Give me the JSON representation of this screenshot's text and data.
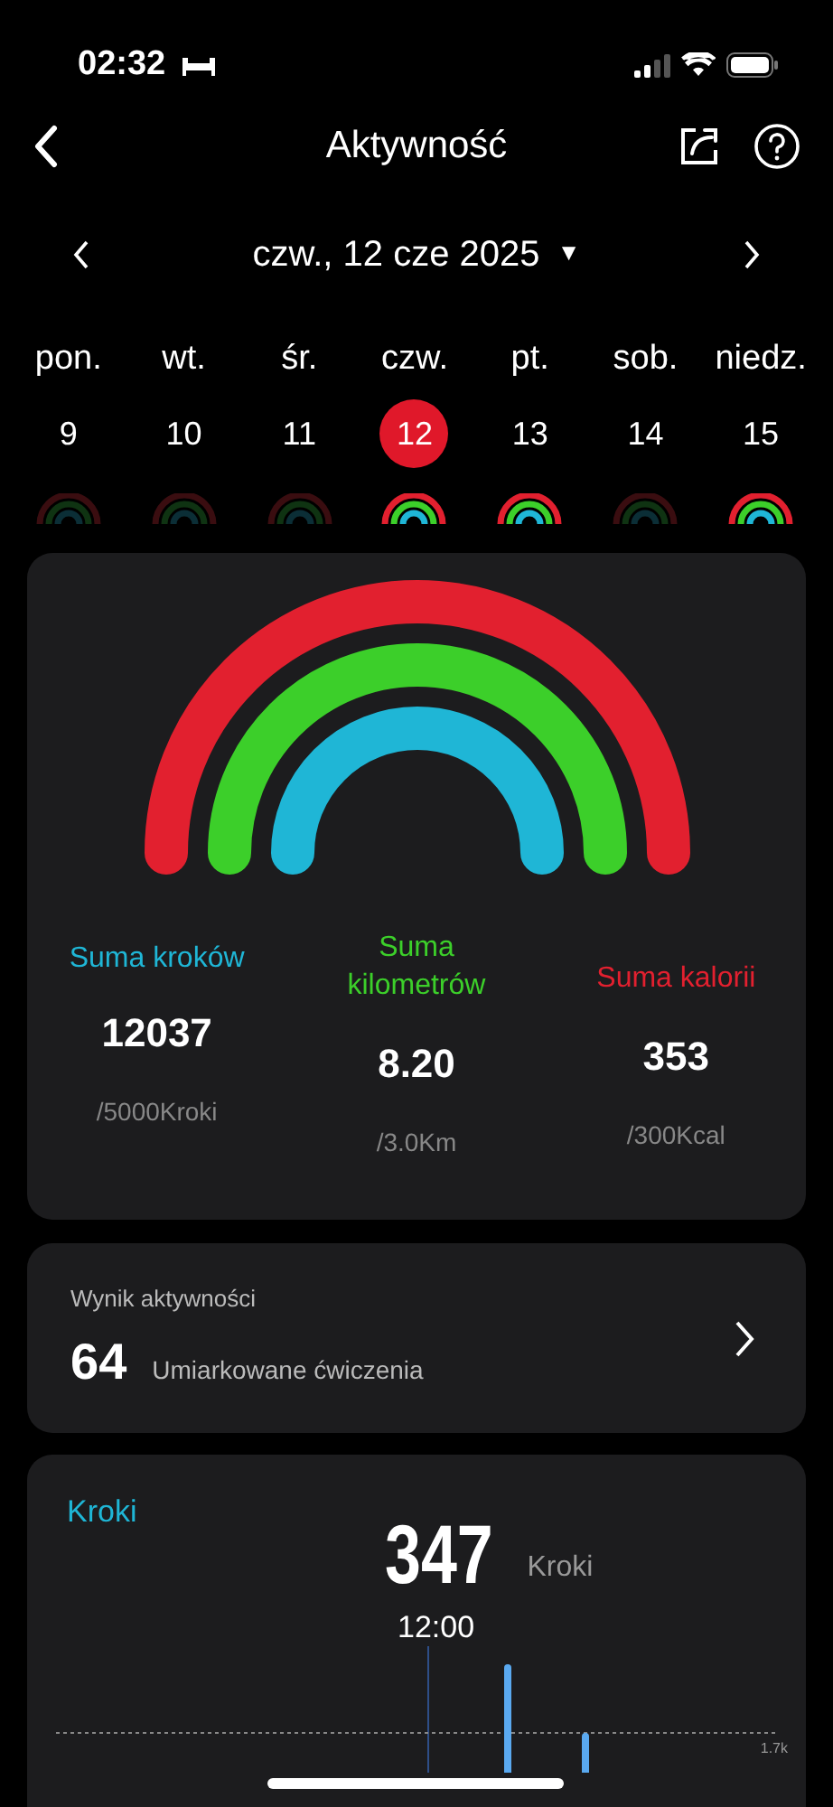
{
  "status_bar": {
    "time": "02:32"
  },
  "header": {
    "title": "Aktywność"
  },
  "date_nav": {
    "date": "czw., 12 cze 2025",
    "dropdown": "▼"
  },
  "week": [
    {
      "weekday": "pon.",
      "day": "9",
      "selected": false,
      "active": false
    },
    {
      "weekday": "wt.",
      "day": "10",
      "selected": false,
      "active": false
    },
    {
      "weekday": "śr.",
      "day": "11",
      "selected": false,
      "active": false
    },
    {
      "weekday": "czw.",
      "day": "12",
      "selected": true,
      "active": true
    },
    {
      "weekday": "pt.",
      "day": "13",
      "selected": false,
      "active": true
    },
    {
      "weekday": "sob.",
      "day": "14",
      "selected": false,
      "active": false
    },
    {
      "weekday": "niedz.",
      "day": "15",
      "selected": false,
      "active": true
    }
  ],
  "summary": [
    {
      "label": "Suma kroków",
      "value": "12037",
      "goal": "/5000Kroki",
      "color": "#1fb6d6"
    },
    {
      "label": "Suma kilometrów",
      "value": "8.20",
      "goal": "/3.0Km",
      "color": "#3ccf2a"
    },
    {
      "label": "Suma kalorii",
      "value": "353",
      "goal": "/300Kcal",
      "color": "#e2202f"
    }
  ],
  "activity_score": {
    "title": "Wynik aktywności",
    "score": "64",
    "description": "Umiarkowane ćwiczenia"
  },
  "steps": {
    "title": "Kroki",
    "value": "347",
    "unit": "Kroki",
    "time": "12:00",
    "reference": "1.7k"
  }
}
